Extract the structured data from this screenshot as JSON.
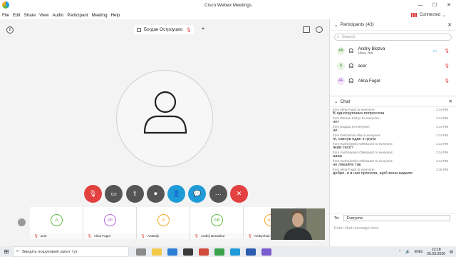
{
  "window": {
    "title": "Cisco Webex Meetings",
    "min": "—",
    "max": "☐",
    "close": "✕"
  },
  "menu": [
    "File",
    "Edit",
    "Share",
    "View",
    "Audio",
    "Participant",
    "Meeting",
    "Help"
  ],
  "connection": "Connected",
  "stage": {
    "active_speaker": "Богдан Остроушко"
  },
  "controls": [
    {
      "name": "mute-button",
      "icon": "mic-off-icon",
      "color": "#e34040",
      "glyph": "🎙"
    },
    {
      "name": "video-button",
      "icon": "video-off-icon",
      "color": "#555555",
      "glyph": "▭"
    },
    {
      "name": "share-button",
      "icon": "share-icon",
      "color": "#555555",
      "glyph": "⇧"
    },
    {
      "name": "record-button",
      "icon": "record-icon",
      "color": "#555555",
      "glyph": "⏺"
    },
    {
      "name": "participants-button",
      "icon": "participants-icon",
      "color": "#1f9bd8",
      "glyph": "👤"
    },
    {
      "name": "chat-button",
      "icon": "chat-icon",
      "color": "#1f9bd8",
      "glyph": "💬"
    },
    {
      "name": "more-button",
      "icon": "more-icon",
      "color": "#555555",
      "glyph": "···"
    },
    {
      "name": "leave-button",
      "icon": "close-icon",
      "color": "#e34040",
      "glyph": "✕"
    }
  ],
  "filmstrip": [
    {
      "initials": "A",
      "name": "acer",
      "color": "#62b846"
    },
    {
      "initials": "AF",
      "name": "Alina Fugol",
      "color": "#b46cd6"
    },
    {
      "initials": "A",
      "name": "Anatoliy",
      "color": "#f5a623"
    },
    {
      "initials": "AB",
      "name": "Andriy Bunaskul",
      "color": "#62b846"
    },
    {
      "initials": "AB",
      "name": "Andrychuk A",
      "color": "#f5a623"
    }
  ],
  "participants": {
    "header": "Participants (43)",
    "search_placeholder": "Search",
    "items": [
      {
        "initials": "AB",
        "name": "Andriy Blozva",
        "role": "Host, me",
        "color": "#62b846"
      },
      {
        "initials": "A",
        "name": "acer",
        "role": "",
        "color": "#62b846"
      },
      {
        "initials": "AF",
        "name": "Alina Fugol",
        "role": "",
        "color": "#b46cd6"
      }
    ]
  },
  "chat": {
    "header": "Chat",
    "messages": [
      {
        "from": "from Alina Fugol to everyone:",
        "time": "1:14 PM",
        "text": "В одногрупника попросила"
      },
      {
        "from": "from Roman Snihyr to everyone:",
        "time": "1:14 PM",
        "text": "нет"
      },
      {
        "from": "from Бодька to everyone:",
        "time": "1:14 PM",
        "text": "не"
      },
      {
        "from": "from Fedorenko Alla to everyone:",
        "time": "1:14 PM",
        "text": "ні, скинув один з групи"
      },
      {
        "from": "from Kushnirenko Oleksandr to everyone:",
        "time": "1:14 PM",
        "text": "який сесії?"
      },
      {
        "from": "from Kushnirenko Oleksandr to everyone:",
        "time": "1:14 PM",
        "text": "аааа"
      },
      {
        "from": "from Kushnirenko Oleksandr to everyone:",
        "time": "1:14 PM",
        "text": "не лякайте так"
      },
      {
        "from": "from Alina Fugol to everyone:",
        "time": "1:15 PM",
        "text": "добре, я в них просила, щоб вони кидали"
      }
    ],
    "to_label": "To:",
    "to_value": "Everyone",
    "input_placeholder": "Enter chat message here"
  },
  "taskbar": {
    "search": "Введіть пошуковий запит тут",
    "lang": "ENG",
    "time": "13:18",
    "date": "25.03.2020"
  }
}
